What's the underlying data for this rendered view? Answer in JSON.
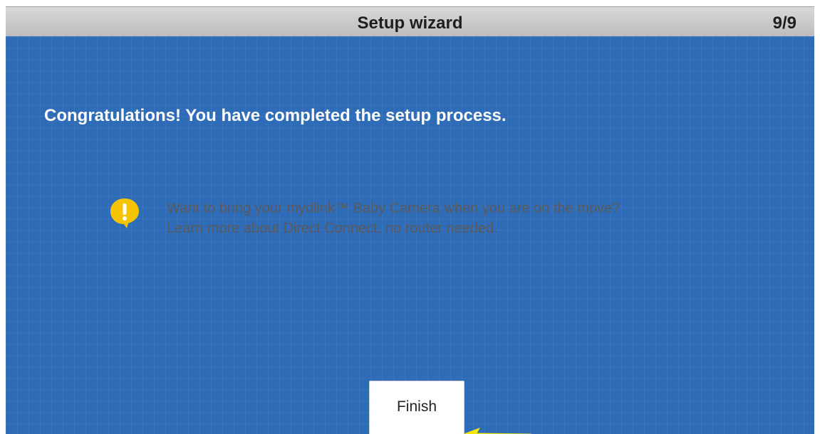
{
  "header": {
    "title": "Setup wizard",
    "step": "9/9"
  },
  "main": {
    "headline": "Congratulations! You have completed the setup process.",
    "tip": {
      "icon": "exclamation-speech-bubble-icon",
      "line1": "Want to bring your mydlink™ Baby Camera when you are on the move?",
      "line2": "Learn more about Direct Connect, no router needed."
    },
    "finish_label": "Finish"
  },
  "annotation": {
    "icon": "arrow-left-icon",
    "color": "#f2e60c"
  },
  "colors": {
    "background": "#2f6cb8",
    "titlebar": "#c9c9c9",
    "tip_icon": "#f5c400",
    "tip_text": "#5a5a5a"
  }
}
